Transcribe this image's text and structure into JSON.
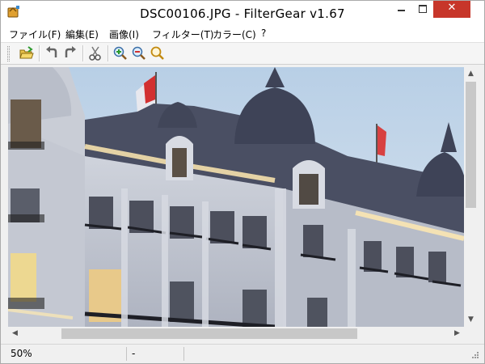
{
  "window": {
    "title": "DSC00106.JPG - FilterGear v1.67",
    "close_glyph": "✕"
  },
  "menu": [
    {
      "label": "ファイル(F)",
      "name": "menu-file"
    },
    {
      "label": "編集(E)",
      "name": "menu-edit"
    },
    {
      "label": "画像(I)",
      "name": "menu-image"
    },
    {
      "label": "フィルター(T)",
      "name": "menu-filter"
    },
    {
      "label": "カラー(C)",
      "name": "menu-color"
    },
    {
      "label": "?",
      "name": "menu-help"
    }
  ],
  "toolbar": {
    "icons": [
      "open-folder-icon",
      "undo-icon",
      "redo-icon",
      "cut-icon",
      "zoom-in-icon",
      "zoom-out-icon",
      "zoom-fit-icon"
    ]
  },
  "canvas": {
    "image_name": "DSC00106.JPG",
    "sky_color": "#c9d9ea",
    "facade_color": "#c8ccd5",
    "roof_color": "#4a4f63",
    "light_color": "#ffe9b0"
  },
  "scrollbars": {
    "up_arrow": "▲",
    "down_arrow": "▼",
    "left_arrow": "◀",
    "right_arrow": "▶"
  },
  "status": {
    "zoom": "50%",
    "info": "-"
  },
  "colors": {
    "close_button": "#c7362a",
    "title_bar": "#ffffff"
  }
}
